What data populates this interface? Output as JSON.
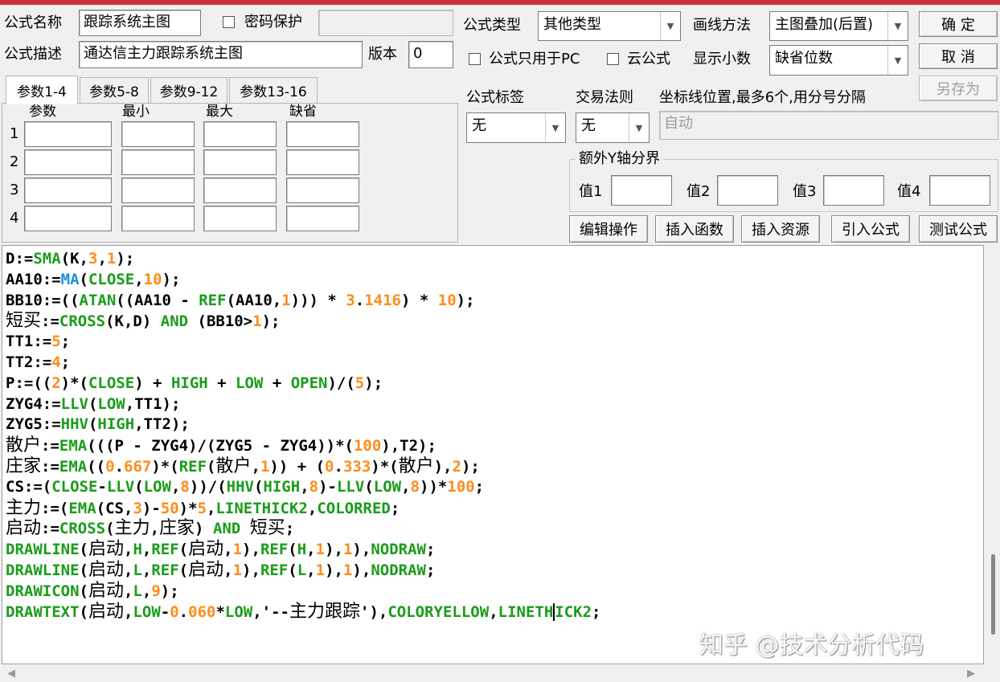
{
  "header": {
    "name_label": "公式名称",
    "name_value": "跟踪系统主图",
    "password_label": "密码保护",
    "desc_label": "公式描述",
    "desc_value": "通达信主力跟踪系统主图",
    "version_label": "版本",
    "version_value": "0",
    "type_label": "公式类型",
    "type_value": "其他类型",
    "draw_label": "画线方法",
    "draw_value": "主图叠加(后置)",
    "pc_only_label": "公式只用于PC",
    "cloud_label": "云公式",
    "decimals_label": "显示小数",
    "decimals_value": "缺省位数"
  },
  "buttons": {
    "ok": "确  定",
    "cancel": "取  消",
    "save_as": "另存为",
    "edit": "编辑操作",
    "insert_func": "插入函数",
    "insert_res": "插入资源",
    "import": "引入公式",
    "test": "测试公式"
  },
  "params": {
    "tabs": [
      "参数1-4",
      "参数5-8",
      "参数9-12",
      "参数13-16"
    ],
    "headers": [
      "参数",
      "最小",
      "最大",
      "缺省"
    ],
    "rows": [
      "1",
      "2",
      "3",
      "4"
    ]
  },
  "meta": {
    "tag_label": "公式标签",
    "tag_value": "无",
    "rule_label": "交易法则",
    "rule_value": "无",
    "axis_label": "坐标线位置,最多6个,用分号分隔",
    "axis_value": "自动",
    "yaxis_group": "额外Y轴分界",
    "yaxis_labels": [
      "值1",
      "值2",
      "值3",
      "值4"
    ]
  },
  "watermark": "知乎 @技术分析代码",
  "code_lines": [
    [
      [
        "t",
        "D:="
      ],
      [
        "k",
        "SMA"
      ],
      [
        "t",
        "(K,"
      ],
      [
        "n",
        "3"
      ],
      [
        "t",
        ","
      ],
      [
        "n",
        "1"
      ],
      [
        "t",
        ");"
      ]
    ],
    [
      [
        "t",
        "AA10:="
      ],
      [
        "f",
        "MA"
      ],
      [
        "t",
        "("
      ],
      [
        "k",
        "CLOSE"
      ],
      [
        "t",
        ","
      ],
      [
        "n",
        "10"
      ],
      [
        "t",
        ");"
      ]
    ],
    [
      [
        "t",
        "BB10:=(("
      ],
      [
        "k",
        "ATAN"
      ],
      [
        "t",
        "((AA10 - "
      ],
      [
        "k",
        "REF"
      ],
      [
        "t",
        "(AA10,"
      ],
      [
        "n",
        "1"
      ],
      [
        "t",
        ")))"
      ],
      [
        "t",
        " * "
      ],
      [
        "n",
        "3"
      ],
      [
        "t",
        "."
      ],
      [
        "n",
        "1416"
      ],
      [
        "t",
        ") * "
      ],
      [
        "n",
        "10"
      ],
      [
        "t",
        ");"
      ]
    ],
    [
      [
        "c",
        "短买"
      ],
      [
        "t",
        ":="
      ],
      [
        "k",
        "CROSS"
      ],
      [
        "t",
        "(K,D) "
      ],
      [
        "k",
        "AND"
      ],
      [
        "t",
        " (BB10>"
      ],
      [
        "n",
        "1"
      ],
      [
        "t",
        ");"
      ]
    ],
    [
      [
        "t",
        "TT1:="
      ],
      [
        "n",
        "5"
      ],
      [
        "t",
        ";"
      ]
    ],
    [
      [
        "t",
        "TT2:="
      ],
      [
        "n",
        "4"
      ],
      [
        "t",
        ";"
      ]
    ],
    [
      [
        "t",
        "P:=(("
      ],
      [
        "n",
        "2"
      ],
      [
        "t",
        ")*("
      ],
      [
        "k",
        "CLOSE"
      ],
      [
        "t",
        ") + "
      ],
      [
        "k",
        "HIGH"
      ],
      [
        "t",
        " + "
      ],
      [
        "k",
        "LOW"
      ],
      [
        "t",
        " + "
      ],
      [
        "k",
        "OPEN"
      ],
      [
        "t",
        ")/("
      ],
      [
        "n",
        "5"
      ],
      [
        "t",
        ");"
      ]
    ],
    [
      [
        "t",
        "ZYG4:="
      ],
      [
        "k",
        "LLV"
      ],
      [
        "t",
        "("
      ],
      [
        "k",
        "LOW"
      ],
      [
        "t",
        ",TT1);"
      ]
    ],
    [
      [
        "t",
        "ZYG5:="
      ],
      [
        "k",
        "HHV"
      ],
      [
        "t",
        "("
      ],
      [
        "k",
        "HIGH"
      ],
      [
        "t",
        ",TT2);"
      ]
    ],
    [
      [
        "c",
        "散户"
      ],
      [
        "t",
        ":="
      ],
      [
        "k",
        "EMA"
      ],
      [
        "t",
        "(((P - ZYG4)/(ZYG5 - ZYG4))*("
      ],
      [
        "n",
        "100"
      ],
      [
        "t",
        "),T2);"
      ]
    ],
    [
      [
        "c",
        "庄家"
      ],
      [
        "t",
        ":="
      ],
      [
        "k",
        "EMA"
      ],
      [
        "t",
        "(("
      ],
      [
        "n",
        "0"
      ],
      [
        "t",
        "."
      ],
      [
        "n",
        "667"
      ],
      [
        "t",
        ")*("
      ],
      [
        "k",
        "REF"
      ],
      [
        "t",
        "("
      ],
      [
        "c",
        "散户"
      ],
      [
        "t",
        ","
      ],
      [
        "n",
        "1"
      ],
      [
        "t",
        ")) + ("
      ],
      [
        "n",
        "0"
      ],
      [
        "t",
        "."
      ],
      [
        "n",
        "333"
      ],
      [
        "t",
        ")*("
      ],
      [
        "c",
        "散户"
      ],
      [
        "t",
        "),"
      ],
      [
        "n",
        "2"
      ],
      [
        "t",
        ");"
      ]
    ],
    [
      [
        "t",
        "CS:=("
      ],
      [
        "k",
        "CLOSE"
      ],
      [
        "t",
        "-"
      ],
      [
        "k",
        "LLV"
      ],
      [
        "t",
        "("
      ],
      [
        "k",
        "LOW"
      ],
      [
        "t",
        ","
      ],
      [
        "n",
        "8"
      ],
      [
        "t",
        "))/("
      ],
      [
        "k",
        "HHV"
      ],
      [
        "t",
        "("
      ],
      [
        "k",
        "HIGH"
      ],
      [
        "t",
        ","
      ],
      [
        "n",
        "8"
      ],
      [
        "t",
        ")-"
      ],
      [
        "k",
        "LLV"
      ],
      [
        "t",
        "("
      ],
      [
        "k",
        "LOW"
      ],
      [
        "t",
        ","
      ],
      [
        "n",
        "8"
      ],
      [
        "t",
        "))*"
      ],
      [
        "n",
        "100"
      ],
      [
        "t",
        ";"
      ]
    ],
    [
      [
        "c",
        "主力"
      ],
      [
        "t",
        ":=("
      ],
      [
        "k",
        "EMA"
      ],
      [
        "t",
        "(CS,"
      ],
      [
        "n",
        "3"
      ],
      [
        "t",
        ")-"
      ],
      [
        "n",
        "50"
      ],
      [
        "t",
        ")*"
      ],
      [
        "n",
        "5"
      ],
      [
        "t",
        ","
      ],
      [
        "k",
        "LINETHICK2"
      ],
      [
        "t",
        ","
      ],
      [
        "k",
        "COLORRED"
      ],
      [
        "t",
        ";"
      ]
    ],
    [
      [
        "c",
        "启动"
      ],
      [
        "t",
        ":="
      ],
      [
        "k",
        "CROSS"
      ],
      [
        "t",
        "("
      ],
      [
        "c",
        "主力"
      ],
      [
        "t",
        ","
      ],
      [
        "c",
        "庄家"
      ],
      [
        "t",
        ") "
      ],
      [
        "k",
        "AND"
      ],
      [
        "t",
        " "
      ],
      [
        "c",
        "短买"
      ],
      [
        "t",
        ";"
      ]
    ],
    [
      [
        "k",
        "DRAWLINE"
      ],
      [
        "t",
        "("
      ],
      [
        "c",
        "启动"
      ],
      [
        "t",
        ","
      ],
      [
        "k",
        "H"
      ],
      [
        "t",
        ","
      ],
      [
        "k",
        "REF"
      ],
      [
        "t",
        "("
      ],
      [
        "c",
        "启动"
      ],
      [
        "t",
        ","
      ],
      [
        "n",
        "1"
      ],
      [
        "t",
        "),"
      ],
      [
        "k",
        "REF"
      ],
      [
        "t",
        "("
      ],
      [
        "k",
        "H"
      ],
      [
        "t",
        ","
      ],
      [
        "n",
        "1"
      ],
      [
        "t",
        "),"
      ],
      [
        "n",
        "1"
      ],
      [
        "t",
        "),"
      ],
      [
        "k",
        "NODRAW"
      ],
      [
        "t",
        ";"
      ]
    ],
    [
      [
        "k",
        "DRAWLINE"
      ],
      [
        "t",
        "("
      ],
      [
        "c",
        "启动"
      ],
      [
        "t",
        ","
      ],
      [
        "k",
        "L"
      ],
      [
        "t",
        ","
      ],
      [
        "k",
        "REF"
      ],
      [
        "t",
        "("
      ],
      [
        "c",
        "启动"
      ],
      [
        "t",
        ","
      ],
      [
        "n",
        "1"
      ],
      [
        "t",
        "),"
      ],
      [
        "k",
        "REF"
      ],
      [
        "t",
        "("
      ],
      [
        "k",
        "L"
      ],
      [
        "t",
        ","
      ],
      [
        "n",
        "1"
      ],
      [
        "t",
        "),"
      ],
      [
        "n",
        "1"
      ],
      [
        "t",
        "),"
      ],
      [
        "k",
        "NODRAW"
      ],
      [
        "t",
        ";"
      ]
    ],
    [
      [
        "k",
        "DRAWICON"
      ],
      [
        "t",
        "("
      ],
      [
        "c",
        "启动"
      ],
      [
        "t",
        ","
      ],
      [
        "k",
        "L"
      ],
      [
        "t",
        ","
      ],
      [
        "n",
        "9"
      ],
      [
        "t",
        ");"
      ]
    ],
    [
      [
        "k",
        "DRAWTEXT"
      ],
      [
        "t",
        "("
      ],
      [
        "c",
        "启动"
      ],
      [
        "t",
        ","
      ],
      [
        "k",
        "LOW"
      ],
      [
        "t",
        "-"
      ],
      [
        "n",
        "0"
      ],
      [
        "t",
        "."
      ],
      [
        "n",
        "060"
      ],
      [
        "t",
        "*"
      ],
      [
        "k",
        "LOW"
      ],
      [
        "t",
        ",'--"
      ],
      [
        "c",
        "主力跟踪"
      ],
      [
        "t",
        "'),"
      ],
      [
        "k",
        "COLORYELLOW"
      ],
      [
        "t",
        ","
      ],
      [
        "k",
        "LINETH"
      ],
      [
        "caret",
        ""
      ],
      [
        "k",
        "ICK2"
      ],
      [
        "t",
        ";"
      ]
    ]
  ]
}
